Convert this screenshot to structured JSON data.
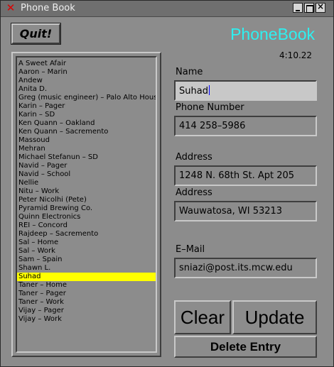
{
  "window": {
    "title": "Phone Book"
  },
  "app": {
    "quit_label": "Quit!",
    "title": "PhoneBook",
    "time": "4:10.22"
  },
  "contacts": [
    "A Sweet Afair",
    "Aaron – Marin",
    "Andew",
    "Anita D.",
    "Greg (music engineer) – Palo Alto House",
    "Karin – Pager",
    "Karin – SD",
    "Ken Quann – Oakland",
    "Ken Quann – Sacremento",
    "Massoud",
    "Mehran",
    "Michael Stefanun – SD",
    "Navid – Pager",
    "Navid – School",
    "Nellie",
    "Nitu – Work",
    "Peter Nicolhi (Pete)",
    "Pyramid Brewing Co.",
    "Quinn Electronics",
    "REI – Concord",
    "Rajdeep – Sacremento",
    "Sal – Home",
    "Sal – Work",
    "Sam – Spain",
    "Shawn L.",
    "Suhad",
    "Taner – Home",
    "Taner – Pager",
    "Taner – Work",
    "Vijay – Pager",
    "Vijay – Work"
  ],
  "selected_index": 25,
  "form": {
    "name_label": "Name",
    "name_value": "Suhad",
    "phone_label": "Phone Number",
    "phone_value": "414 258–5986",
    "address_label": "Address",
    "address1_value": "1248 N. 68th St. Apt 205",
    "address2_label": "Address",
    "address2_value": "Wauwatosa, WI 53213",
    "email_label": "E–Mail",
    "email_value": "sniazi@post.its.mcw.edu"
  },
  "buttons": {
    "clear": "Clear",
    "update": "Update",
    "delete": "Delete Entry"
  },
  "colors": {
    "accent_title": "#2ef0f0",
    "selection": "#ffff00",
    "caret": "#0000ff"
  },
  "icons": {
    "close": "x-close-icon",
    "minimize": "minimize-icon",
    "maximize": "maximize-icon",
    "window_close": "window-close-icon"
  }
}
